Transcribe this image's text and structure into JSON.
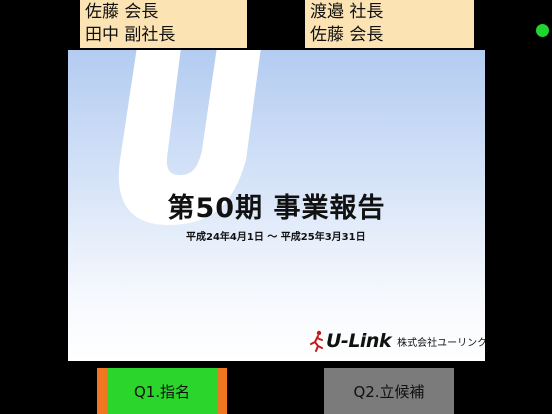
{
  "name_cards": {
    "left": {
      "line1": "佐藤 会長",
      "line2": "田中 副社長"
    },
    "right": {
      "line1": "渡邉 社長",
      "line2": "佐藤 会長"
    }
  },
  "status_indicator": {
    "color": "#22d42e"
  },
  "slide": {
    "title": "第50期 事業報告",
    "period": "平成24年4月1日 ～ 平成25年3月31日",
    "brand_name": "U-Link",
    "company": "株式会社ユーリンク",
    "logo_icon": "u-letter-logo"
  },
  "buttons": {
    "q1": {
      "label": "Q1.指名",
      "color": "#2bd52b",
      "accent": "#f07622"
    },
    "q2": {
      "label": "Q2.立候補",
      "color": "#7b7b7b"
    }
  }
}
